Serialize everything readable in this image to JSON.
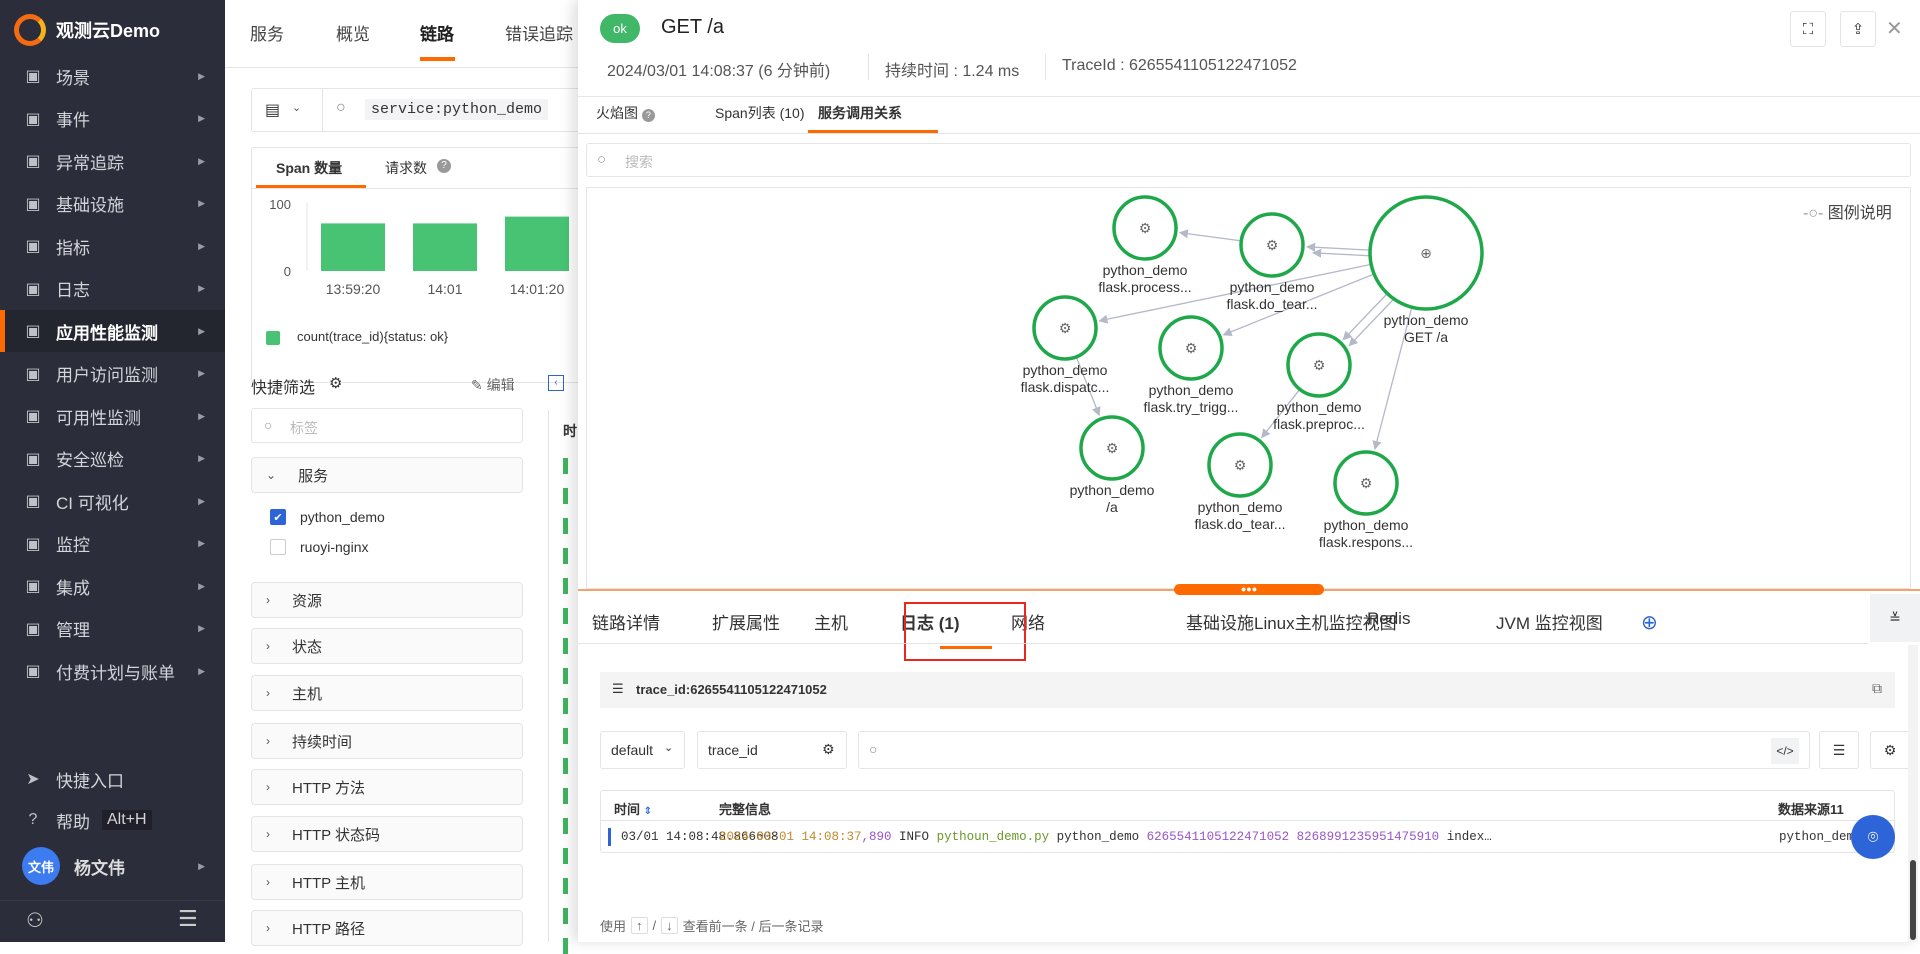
{
  "sidebar": {
    "brand": "观测云Demo",
    "items": [
      {
        "label": "场景",
        "icon": "monitor-icon"
      },
      {
        "label": "事件",
        "icon": "calendar-icon"
      },
      {
        "label": "异常追踪",
        "icon": "scan-icon"
      },
      {
        "label": "基础设施",
        "icon": "cluster-icon"
      },
      {
        "label": "指标",
        "icon": "bar-chart-icon"
      },
      {
        "label": "日志",
        "icon": "log-icon"
      },
      {
        "label": "应用性能监测",
        "icon": "apm-icon",
        "active": true
      },
      {
        "label": "用户访问监测",
        "icon": "rum-icon"
      },
      {
        "label": "可用性监测",
        "icon": "probe-icon"
      },
      {
        "label": "安全巡检",
        "icon": "shield-icon"
      },
      {
        "label": "CI 可视化",
        "icon": "ci-icon"
      },
      {
        "label": "监控",
        "icon": "monitor-alarm-icon"
      },
      {
        "label": "集成",
        "icon": "integration-icon"
      },
      {
        "label": "管理",
        "icon": "sliders-icon"
      },
      {
        "label": "付费计划与账单",
        "icon": "billing-icon"
      }
    ],
    "shortcut": "快捷入口",
    "help": "帮助",
    "help_key": "Alt+H",
    "user_avatar": "文伟",
    "user_name": "杨文伟"
  },
  "left": {
    "tabs": [
      "服务",
      "概览",
      "链路",
      "错误追踪"
    ],
    "active_tab": "链路",
    "query": "service:python_demo",
    "chart_tabs": [
      "Span 数量",
      "请求数"
    ],
    "chart_data": {
      "type": "bar",
      "categories": [
        "13:59:20",
        "14:01",
        "14:01:20"
      ],
      "values": [
        70,
        70,
        80
      ],
      "ylim": [
        0,
        100
      ],
      "yticks": [
        "100",
        "0"
      ],
      "legend": "count(trace_id){status: ok}",
      "color": "#48c374"
    },
    "quick_filter": "快捷筛选",
    "edit": "编辑",
    "tag_placeholder": "标签",
    "service_group": "服务",
    "services": [
      {
        "name": "python_demo",
        "checked": true
      },
      {
        "name": "ruoyi-nginx",
        "checked": false
      }
    ],
    "groups": [
      "资源",
      "状态",
      "主机",
      "持续时间",
      "HTTP 方法",
      "HTTP 状态码",
      "HTTP 主机",
      "HTTP 路径"
    ],
    "table_header": "时"
  },
  "drawer": {
    "status": "ok",
    "title": "GET /a",
    "time": "2024/03/01 14:08:37 (6 分钟前)",
    "duration": "持续时间 : 1.24 ms",
    "trace_id": "TraceId : 6265541105122471052",
    "tabs": [
      "火焰图",
      "Span列表 (10)",
      "服务调用关系"
    ],
    "active_tab": "服务调用关系",
    "search_placeholder": "搜索",
    "legend_label": "图例说明",
    "nodes": [
      {
        "service": "python_demo",
        "name": "GET /a"
      },
      {
        "service": "python_demo",
        "name": "flask.process..."
      },
      {
        "service": "python_demo",
        "name": "flask.do_tear..."
      },
      {
        "service": "python_demo",
        "name": "flask.dispatc..."
      },
      {
        "service": "python_demo",
        "name": "flask.try_trigg..."
      },
      {
        "service": "python_demo",
        "name": "flask.preproc..."
      },
      {
        "service": "python_demo",
        "name": "/a"
      },
      {
        "service": "python_demo",
        "name": "flask.do_tear..."
      },
      {
        "service": "python_demo",
        "name": "flask.respons..."
      }
    ],
    "bottom_tabs": [
      "链路详情",
      "扩展属性",
      "主机",
      "日志 (1)",
      "网络",
      "基础设施Linux主机监控视图",
      "Redis",
      "JVM 监控视图"
    ],
    "active_bottom_tab": "日志 (1)",
    "filter_key": "trace_id",
    "filter_value": "6265541105122471052",
    "index_select": "default",
    "field_select": "trace_id",
    "columns": [
      "时间",
      "完整信息",
      "数据来源11"
    ],
    "log_row": {
      "time": "03/01 14:08:48.866608",
      "msg_date": "2024-03-01 14:08:37",
      "msg_ms": ",890",
      "msg_level": " INFO ",
      "msg_file": "pythoun_demo.py",
      "msg_service": " python_demo ",
      "msg_trace": "6265541105122471052 8268991235951475910",
      "msg_rest": " index…",
      "source": "python_demo"
    },
    "footer_use": "使用",
    "footer_up": "↑",
    "footer_sep": "/",
    "footer_down": "↓",
    "footer_hint": "查看前一条 / 后一条记录"
  }
}
